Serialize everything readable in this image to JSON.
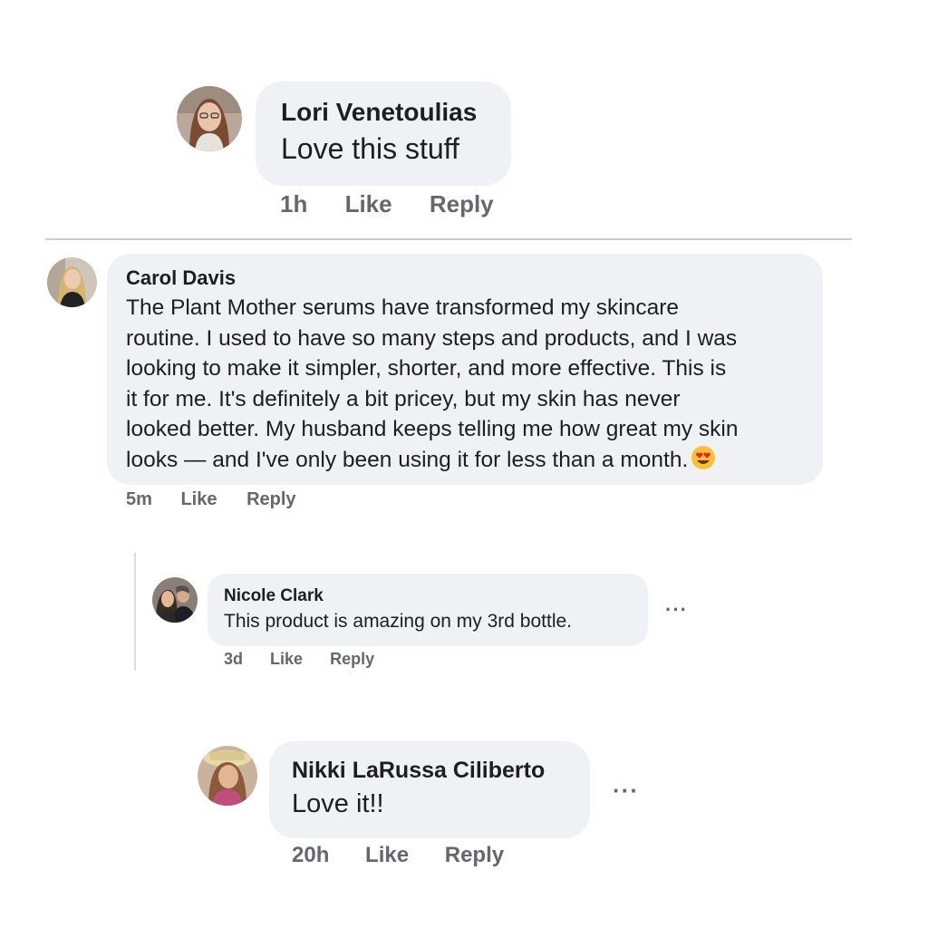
{
  "comments": [
    {
      "author": "Lori Venetoulias",
      "text": "Love this stuff",
      "time": "1h",
      "like_label": "Like",
      "reply_label": "Reply"
    },
    {
      "author": "Carol Davis",
      "text_lines": [
        "The Plant Mother serums have transformed my skincare",
        "routine. I used to have so many steps and products, and I was",
        "looking to make it simpler, shorter, and more effective. This is",
        "it for me. It's definitely a bit pricey, but my skin has never",
        "looked better. My husband keeps telling me how great my skin",
        "looks — and I've only been using it for less than a month."
      ],
      "emoji": "heart-eyes-emoji",
      "time": "5m",
      "like_label": "Like",
      "reply_label": "Reply"
    },
    {
      "author": "Nicole Clark",
      "text": "This product is amazing on my 3rd bottle.",
      "time": "3d",
      "like_label": "Like",
      "reply_label": "Reply",
      "more_label": "···"
    },
    {
      "author": "Nikki LaRussa Ciliberto",
      "text": "Love it!!",
      "time": "20h",
      "like_label": "Like",
      "reply_label": "Reply",
      "more_label": "···"
    }
  ],
  "colors": {
    "bubble": "#f0f1f5",
    "meta_text": "#65676b",
    "body_text": "#1c1e21"
  }
}
